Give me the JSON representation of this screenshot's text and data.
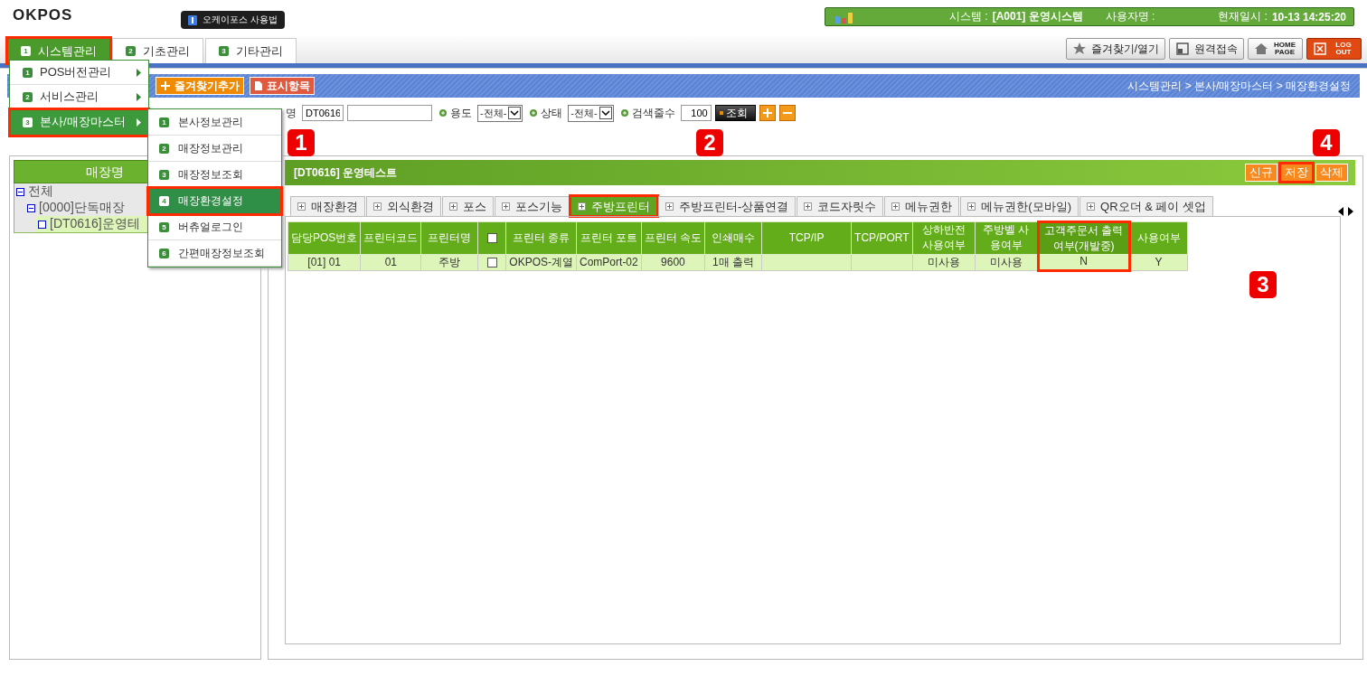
{
  "header": {
    "logo": "OKPOS",
    "help_label": "오케이포스 사용법",
    "info_bar": {
      "system_label": "시스템 :",
      "system_value": "[A001] 운영시스템",
      "user_label": "사용자명 :",
      "datetime_label": "현재일시 :",
      "datetime_value": "10-13 14:25:20"
    }
  },
  "main_tabs": [
    {
      "number": "1",
      "label": "시스템관리",
      "selected": true,
      "highlighted": true
    },
    {
      "number": "2",
      "label": "기초관리",
      "selected": false,
      "highlighted": false
    },
    {
      "number": "3",
      "label": "기타관리",
      "selected": false,
      "highlighted": false
    }
  ],
  "top_buttons": [
    {
      "kind": "favorites",
      "label": "즐겨찾기/열기"
    },
    {
      "kind": "remote",
      "label": "원격접속"
    },
    {
      "kind": "home",
      "label": "HOME PAGE"
    },
    {
      "kind": "logout",
      "label": "LOG OUT"
    }
  ],
  "toolbar": {
    "buttons": [
      {
        "kind": "add",
        "label": "즐겨찾기추가"
      },
      {
        "kind": "display",
        "label": "표시항목"
      }
    ],
    "breadcrumb": "시스템관리 > 본사/매장마스터 > 매장환경설정"
  },
  "filters": {
    "store_label": "명",
    "store_code": "DT0616",
    "fields": [
      {
        "kind": "select",
        "label": "용도",
        "value": "-전체-"
      },
      {
        "kind": "select",
        "label": "상태",
        "value": "-전체-"
      },
      {
        "kind": "input",
        "label": "검색줄수",
        "value": "100"
      }
    ],
    "search_button": "조회"
  },
  "store_tree": {
    "title": "매장명",
    "nodes": [
      {
        "label": "전체",
        "expanded": true,
        "selected": false,
        "children": [
          {
            "label": "[0000]단독매장",
            "expanded": true,
            "selected": false,
            "children": [
              {
                "label": "[DT0616]운영테",
                "expanded": false,
                "selected": true
              }
            ]
          }
        ]
      }
    ]
  },
  "detail": {
    "title": "[DT0616] 운영테스트",
    "actions": [
      {
        "label": "신규",
        "highlighted": false
      },
      {
        "label": "저장",
        "highlighted": true
      },
      {
        "label": "삭제",
        "highlighted": false
      }
    ],
    "tabs": [
      {
        "label": "매장환경",
        "selected": false,
        "highlighted": false
      },
      {
        "label": "외식환경",
        "selected": false,
        "highlighted": false
      },
      {
        "label": "포스",
        "selected": false,
        "highlighted": false
      },
      {
        "label": "포스기능",
        "selected": false,
        "highlighted": false
      },
      {
        "label": "주방프린터",
        "selected": true,
        "highlighted": true
      },
      {
        "label": "주방프린터-상품연결",
        "selected": false,
        "highlighted": false
      },
      {
        "label": "코드자릿수",
        "selected": false,
        "highlighted": false
      },
      {
        "label": "메뉴권한",
        "selected": false,
        "highlighted": false
      },
      {
        "label": "메뉴권한(모바일)",
        "selected": false,
        "highlighted": false
      },
      {
        "label": "QR오더 & 페이 셋업",
        "selected": false,
        "highlighted": false
      }
    ],
    "table": {
      "columns": [
        {
          "kind": "text",
          "label": "담당POS번호",
          "highlighted": false
        },
        {
          "kind": "text",
          "label": "프린터코드",
          "highlighted": false
        },
        {
          "kind": "text",
          "label": "프린터명",
          "highlighted": false
        },
        {
          "kind": "checkbox",
          "checked": false,
          "highlighted": false
        },
        {
          "kind": "text",
          "label": "프린터 종류",
          "highlighted": false
        },
        {
          "kind": "text",
          "label": "프린터 포트",
          "highlighted": false
        },
        {
          "kind": "text",
          "label": "프린터 속도",
          "highlighted": false
        },
        {
          "kind": "text",
          "label": "인쇄매수",
          "highlighted": false
        },
        {
          "kind": "text",
          "label": "TCP/IP",
          "highlighted": false
        },
        {
          "kind": "text",
          "label": "TCP/PORT",
          "highlighted": false
        },
        {
          "kind": "text",
          "label": "상하반전 사용여부",
          "highlighted": false
        },
        {
          "kind": "text",
          "label": "주방벨 사용여부",
          "highlighted": false
        },
        {
          "kind": "text",
          "label": "고객주문서 출력여부(개발중)",
          "highlighted": true
        },
        {
          "kind": "text",
          "label": "사용여부",
          "highlighted": false
        }
      ],
      "rows": [
        {
          "selected": true,
          "cells": [
            "[01] 01",
            "01",
            "주방",
            {
              "checked": false
            },
            "OKPOS-계열",
            "ComPort-02",
            "9600",
            "1매 출력",
            null,
            null,
            "미사용",
            "미사용",
            "N",
            "Y"
          ]
        }
      ]
    }
  },
  "menu": {
    "items": [
      {
        "number": "1",
        "label": "POS버전관리",
        "has_submenu": true,
        "selected": false,
        "highlighted": false
      },
      {
        "number": "2",
        "label": "서비스관리",
        "has_submenu": true,
        "selected": false,
        "highlighted": false
      },
      {
        "number": "3",
        "label": "본사/매장마스터",
        "has_submenu": true,
        "selected": true,
        "highlighted": true
      }
    ]
  },
  "submenu": {
    "items": [
      {
        "number": "1",
        "label": "본사정보관리",
        "selected": false,
        "highlighted": false
      },
      {
        "number": "2",
        "label": "매장정보관리",
        "selected": false,
        "highlighted": false
      },
      {
        "number": "3",
        "label": "매장정보조회",
        "selected": false,
        "highlighted": false
      },
      {
        "number": "4",
        "label": "매장환경설정",
        "selected": true,
        "highlighted": true
      },
      {
        "number": "5",
        "label": "버츄얼로그인",
        "selected": false,
        "highlighted": false
      },
      {
        "number": "6",
        "label": "간편매장정보조회",
        "selected": false,
        "highlighted": false
      }
    ]
  },
  "callouts": [
    {
      "number": "1"
    },
    {
      "number": "2"
    },
    {
      "number": "3"
    },
    {
      "number": "4"
    }
  ]
}
